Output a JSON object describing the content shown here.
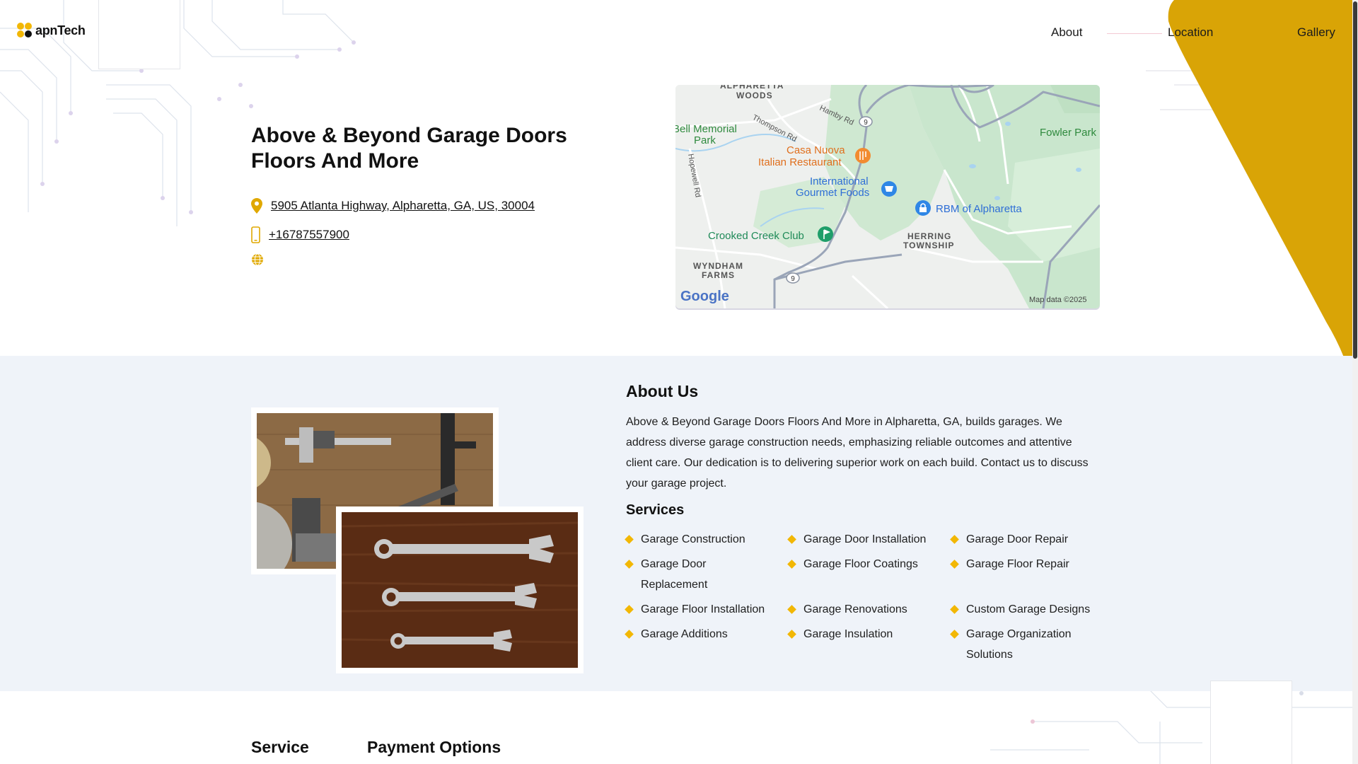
{
  "header": {
    "logo_text": "apnTech",
    "nav": {
      "about": "About",
      "location": "Location",
      "gallery": "Gallery"
    }
  },
  "business": {
    "name": "Above & Beyond Garage Doors Floors And More",
    "address": "5905 Atlanta Highway, Alpharetta, GA, US, 30004",
    "phone": "+16787557900"
  },
  "map": {
    "labels": {
      "alpharetta_woods_1": "ALPHARETTA",
      "alpharetta_woods_2": "WOODS",
      "hamby": "Hamby Rd",
      "thompson": "Thompson Rd",
      "memorial_1": "Bell Memorial",
      "memorial_2": "Park",
      "fowler": "Fowler Park",
      "casa_1": "Casa Nuova",
      "casa_2": "Italian Restaurant",
      "hopewell": "Hopewell Rd",
      "intl_1": "International",
      "intl_2": "Gourmet Foods",
      "rbm": "RBM of Alpharetta",
      "crooked": "Crooked Creek Club",
      "herring_1": "HERRING",
      "herring_2": "TOWNSHIP",
      "wyndham_1": "WYNDHAM",
      "wyndham_2": "FARMS",
      "route_9a": "9",
      "route_9b": "9",
      "google": "Google",
      "attribution": "Map data ©2025"
    }
  },
  "about": {
    "title": "About Us",
    "text": "Above & Beyond Garage Doors Floors And More in Alpharetta, GA, builds garages. We address diverse garage construction needs, emphasizing reliable outcomes and attentive client care. Our dedication is to delivering superior work on each build. Contact us to discuss your garage project.",
    "services_title": "Services",
    "services": [
      "Garage Construction",
      "Garage Door Installation",
      "Garage Door Repair",
      "Garage Door Replacement",
      "Garage Floor Coatings",
      "Garage Floor Repair",
      "Garage Floor Installation",
      "Garage Renovations",
      "Custom Garage Designs",
      "Garage Additions",
      "Garage Insulation",
      "Garage Organization Solutions"
    ]
  },
  "bottom": {
    "service_heading": "Service",
    "payment_heading": "Payment Options"
  },
  "colors": {
    "accent": "#f2b705",
    "wedge": "#d9a406",
    "band": "#eff3f9"
  }
}
